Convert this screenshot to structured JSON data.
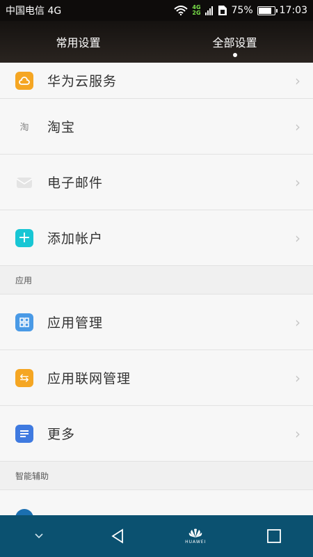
{
  "status_bar": {
    "carrier": "中国电信 4G",
    "net_top": "4G",
    "net_bottom": "2G",
    "battery_pct": "75%",
    "battery_fraction": 0.75,
    "time": "17:03"
  },
  "tabs": [
    {
      "label": "常用设置",
      "selected": false
    },
    {
      "label": "全部设置",
      "selected": true
    }
  ],
  "accounts": [
    {
      "label": "华为云服务",
      "icon": "cloud-icon",
      "color": "#f5a623"
    },
    {
      "label": "淘宝",
      "icon": "taobao-icon",
      "icon_text": "淘",
      "color": "#f7f7f7"
    },
    {
      "label": "电子邮件",
      "icon": "email-icon",
      "color": "#dcdcdc"
    },
    {
      "label": "添加帐户",
      "icon": "plus-icon",
      "icon_text": "+",
      "color": "#18c6d4"
    }
  ],
  "section_apps": {
    "title": "应用"
  },
  "apps": [
    {
      "label": "应用管理",
      "icon": "grid-icon",
      "color": "#4a9ae6"
    },
    {
      "label": "应用联网管理",
      "icon": "arrows-icon",
      "icon_text": "⇆",
      "color": "#f5a623"
    },
    {
      "label": "更多",
      "icon": "list-icon",
      "color": "#3f7ae0"
    }
  ],
  "section_assist": {
    "title": "智能辅助"
  },
  "nav": {
    "brand": "HUAWEI"
  }
}
